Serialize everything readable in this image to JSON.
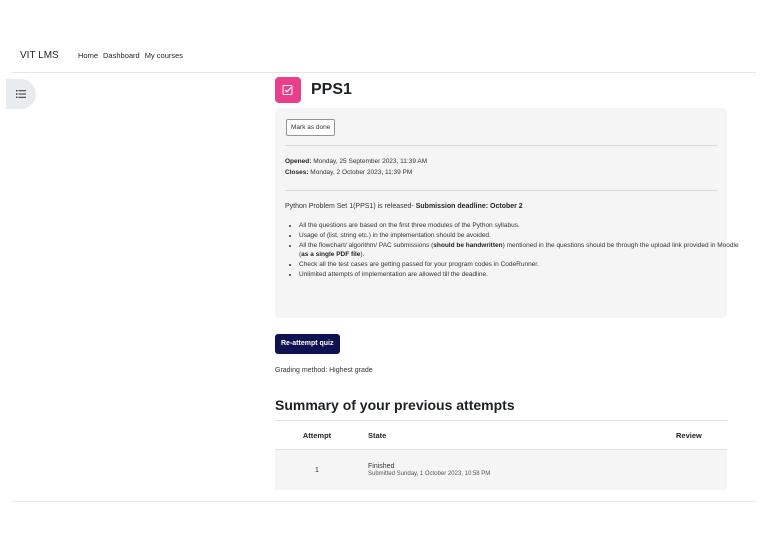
{
  "nav": {
    "brand": "VIT LMS",
    "links": [
      "Home",
      "Dashboard",
      "My courses"
    ]
  },
  "activity": {
    "title": "PPS1",
    "mark_done": "Mark as done",
    "opened_label": "Opened:",
    "opened_value": "Monday, 25 September 2023, 11:39 AM",
    "closes_label": "Closes:",
    "closes_value": "Monday, 2 October 2023, 11:39 PM",
    "intro_text": "Python Problem Set 1(PPS1) is released- ",
    "intro_bold": "Submission deadline: October 2",
    "bullet1": "All the questions are based on the first three modules of the Python syllabus.",
    "bullet2": "Usage of (list, string etc.) in the implementation should be avoided.",
    "bullet3_a": "All the flowchart/ algorithm/ PAC submissions (",
    "bullet3_b": "should be handwritten",
    "bullet3_c": ") mentioned in the questions should be through the upload link provided in Moodle (",
    "bullet3_d": "as a single PDF file",
    "bullet3_e": ").",
    "bullet4": "Check all the test cases are getting passed for your program codes in CodeRunner.",
    "bullet5": "Unlimited attempts of implementation are allowed till the deadline."
  },
  "quiz": {
    "reattempt": "Re-attempt quiz",
    "grading": "Grading method: Highest grade",
    "summary_title": "Summary of your previous attempts",
    "columns": {
      "attempt": "Attempt",
      "state": "State",
      "review": "Review"
    },
    "row": {
      "attempt": "1",
      "state": "Finished",
      "submitted": "Submitted Sunday, 1 October 2023, 10:58 PM"
    }
  },
  "colors": {
    "accent": "#e83e8c",
    "primary": "#0f1250"
  },
  "icons": {
    "drawer": "list-icon",
    "activity": "assignment-check-icon"
  }
}
